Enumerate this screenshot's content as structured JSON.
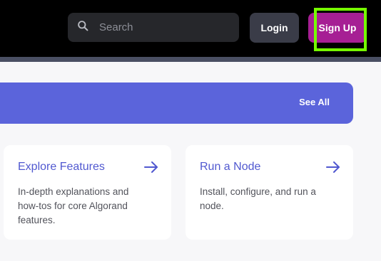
{
  "header": {
    "search": {
      "placeholder": "Search",
      "icon": "search-icon"
    },
    "login_label": "Login",
    "signup_label": "Sign Up",
    "colors": {
      "background": "#000000",
      "search_bg": "#26272b",
      "login_bg": "#3a3c48",
      "signup_bg": "#a61f94",
      "highlight": "#76ff00"
    }
  },
  "banner": {
    "see_all_label": "See All",
    "color": "#5b64db"
  },
  "cards": [
    {
      "title": "Explore Features",
      "description": "In-depth explanations and how-tos for core Algorand features.",
      "icon": "arrow-right-icon"
    },
    {
      "title": "Run a Node",
      "description": "Install, configure, and run a node.",
      "icon": "arrow-right-icon"
    }
  ]
}
